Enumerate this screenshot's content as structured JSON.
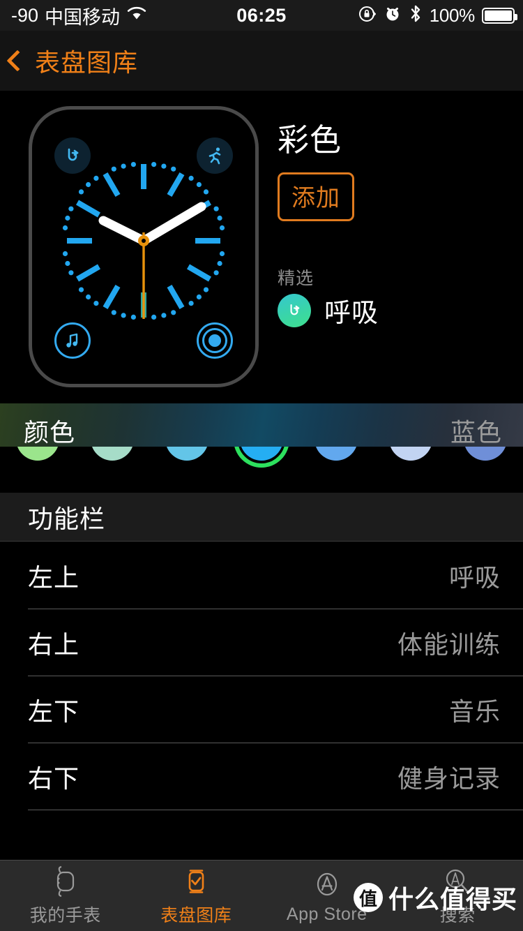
{
  "status_bar": {
    "signal": "-90",
    "carrier": "中国移动",
    "wifi_icon": "wifi-icon",
    "time": "06:25",
    "rotation_lock_icon": "rotation-lock-icon",
    "alarm_icon": "alarm-clock-icon",
    "bluetooth_icon": "bluetooth-icon",
    "battery_percent": "100%"
  },
  "navbar": {
    "back_icon": "chevron-left-icon",
    "title": "表盘图库"
  },
  "preview": {
    "watch_face_name": "彩色",
    "add_label": "添加",
    "complications": {
      "top_left": "breathe-icon",
      "top_right": "workout-running-icon",
      "bottom_left": "music-note-icon",
      "bottom_right": "activity-rings-icon"
    }
  },
  "featured": {
    "label": "精选",
    "item_name": "呼吸",
    "item_icon": "breathe-icon"
  },
  "color_section": {
    "label": "颜色",
    "value": "蓝色",
    "swatches": [
      {
        "name": "绿色",
        "color": "#9BE58C",
        "selected": false
      },
      {
        "name": "薄荷色",
        "color": "#A6DCC8",
        "selected": false
      },
      {
        "name": "浅蓝色",
        "color": "#63C5E8",
        "selected": false
      },
      {
        "name": "蓝色",
        "color": "#25AEF3",
        "selected": true
      },
      {
        "name": "天蓝色",
        "color": "#62A8EE",
        "selected": false
      },
      {
        "name": "淡蓝色",
        "color": "#C2D4F2",
        "selected": false
      },
      {
        "name": "靛蓝色",
        "color": "#6F8FD8",
        "selected": false
      }
    ],
    "selection_ring_color": "#2DE05E"
  },
  "complication_section": {
    "header": "功能栏",
    "rows": [
      {
        "key": "左上",
        "value": "呼吸"
      },
      {
        "key": "右上",
        "value": "体能训练"
      },
      {
        "key": "左下",
        "value": "音乐"
      },
      {
        "key": "右下",
        "value": "健身记录"
      }
    ]
  },
  "tabbar": {
    "tabs": [
      {
        "label": "我的手表",
        "icon": "watch-icon",
        "active": false
      },
      {
        "label": "表盘图库",
        "icon": "watch-face-check-icon",
        "active": true
      },
      {
        "label": "App Store",
        "icon": "app-store-icon",
        "active": false
      },
      {
        "label": "搜索",
        "icon": "search-icon",
        "active": false
      }
    ],
    "accent_color": "#F08018"
  },
  "watermark": {
    "badge": "值",
    "text": "什么值得买"
  }
}
